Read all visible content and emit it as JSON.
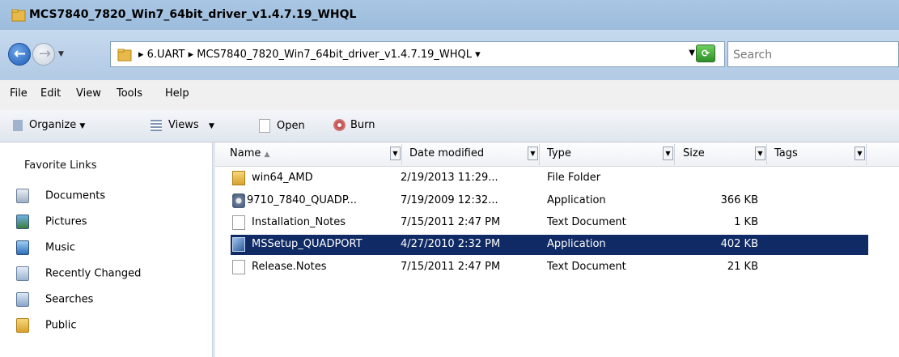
{
  "window": {
    "title": "MCS7840_7820_Win7_64bit_driver_v1.4.7.19_WHQL"
  },
  "address": {
    "crumbs": "▸ 6.UART ▸ MCS7840_7820_Win7_64bit_driver_v1.4.7.19_WHQL ▾"
  },
  "search": {
    "placeholder": "Search"
  },
  "menu": {
    "file": "File",
    "edit": "Edit",
    "view": "View",
    "tools": "Tools",
    "help": "Help"
  },
  "toolbar": {
    "organize": "Organize",
    "views": "Views",
    "open": "Open",
    "burn": "Burn"
  },
  "sidebar": {
    "title": "Favorite Links",
    "links": [
      "Documents",
      "Pictures",
      "Music",
      "Recently Changed",
      "Searches",
      "Public"
    ]
  },
  "columns": {
    "name": "Name",
    "date": "Date modified",
    "type": "Type",
    "size": "Size",
    "tags": "Tags"
  },
  "files": [
    {
      "name": "win64_AMD",
      "date": "2/19/2013 11:29...",
      "type": "File Folder",
      "size": ""
    },
    {
      "name": "9710_7840_QUADP...",
      "date": "7/19/2009 12:32...",
      "type": "Application",
      "size": "366 KB"
    },
    {
      "name": "Installation_Notes",
      "date": "7/15/2011 2:47 PM",
      "type": "Text Document",
      "size": "1 KB"
    },
    {
      "name": "MSSetup_QUADPORT",
      "date": "4/27/2010 2:32 PM",
      "type": "Application",
      "size": "402 KB"
    },
    {
      "name": "Release.Notes",
      "date": "7/15/2011 2:47 PM",
      "type": "Text Document",
      "size": "21 KB"
    }
  ],
  "colors": {
    "selection": "#0f2a64",
    "title_bar": "#a9c6e4"
  }
}
